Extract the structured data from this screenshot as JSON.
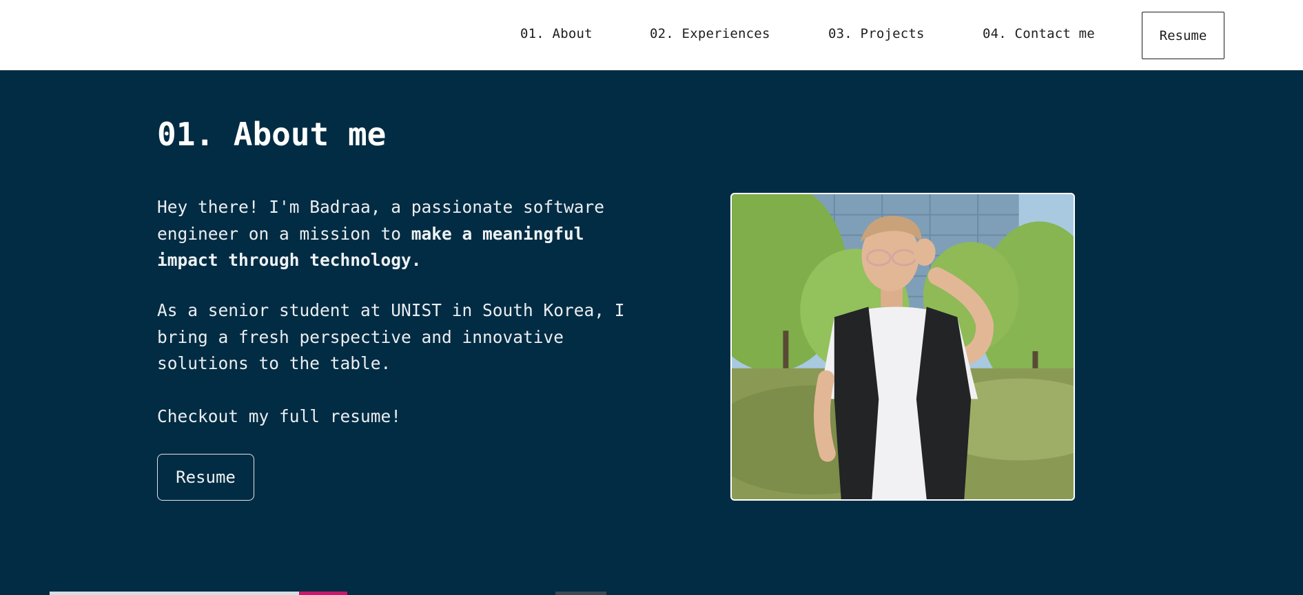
{
  "nav": {
    "links": [
      "01. About",
      "02. Experiences",
      "03. Projects",
      "04. Contact me"
    ],
    "resume_label": "Resume"
  },
  "about": {
    "title": "01. About me",
    "intro_plain": "Hey there! I'm Badraa, a passionate software engineer on a mission to ",
    "intro_bold": "make a meaningful impact through technology.",
    "second": "As a senior student at UNIST in South Korea, I bring a fresh perspective and innovative solutions to the table.",
    "third": "Checkout my full resume!",
    "resume_button": "Resume"
  },
  "colors": {
    "background": "#022c43",
    "navbar": "#ffffff",
    "text": "#eaeef1"
  }
}
